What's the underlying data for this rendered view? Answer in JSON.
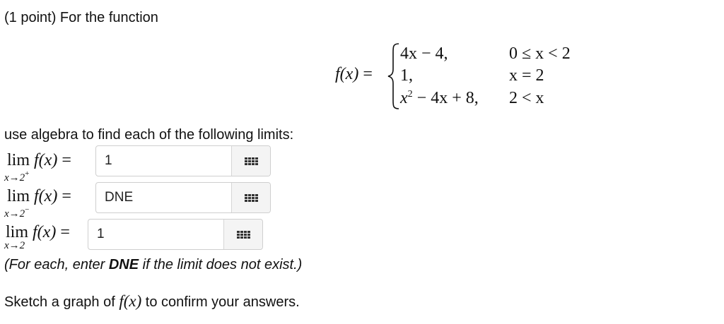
{
  "header": "(1 point) For the function",
  "function": {
    "name": "f(x)",
    "equals": "=",
    "pieces": [
      {
        "expression": "4x − 4,",
        "condition": "0 ≤ x < 2"
      },
      {
        "expression": "1,",
        "condition": "x = 2"
      },
      {
        "expression_base": "x",
        "expression_exp": "2",
        "expression_rest": " − 4x + 8,",
        "condition": "2 < x"
      }
    ]
  },
  "instruction": "use algebra to find each of the following limits:",
  "limits": [
    {
      "lim": "lim",
      "func": "f(x)",
      "equals": "=",
      "approach": "x→2",
      "side": "+",
      "answer": "1"
    },
    {
      "lim": "lim",
      "func": "f(x)",
      "equals": "=",
      "approach": "x→2",
      "side": "−",
      "answer": "DNE"
    },
    {
      "lim": "lim",
      "func": "f(x)",
      "equals": "=",
      "approach": "x→2",
      "side": "",
      "answer": "1"
    }
  ],
  "note": {
    "prefix": "(For each, enter ",
    "bold": "DNE",
    "suffix": " if the limit does not exist.)"
  },
  "footer": {
    "prefix": "Sketch a graph of ",
    "func": "f(x)",
    "suffix": " to confirm your answers."
  },
  "icons": {
    "palette": "equation-palette-icon"
  }
}
